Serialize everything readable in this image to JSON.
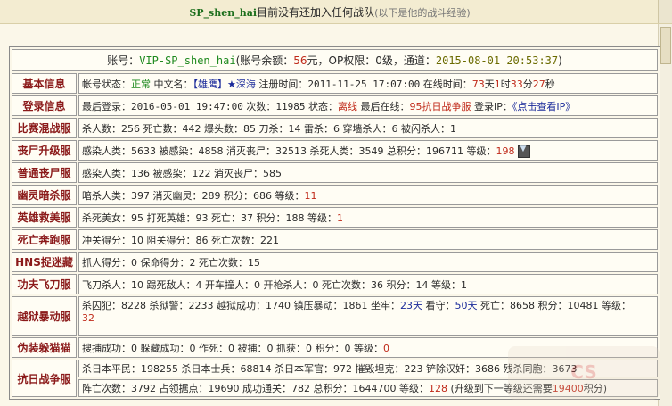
{
  "header": {
    "name": "SP_shen_hai",
    "text": "目前没有还加入任何战队",
    "note": "(以下是他的战斗经验)"
  },
  "account": {
    "prefix": "账号：",
    "id": "VIP-SP_shen_hai",
    "balance_prefix": "(账号余额：",
    "balance": "56",
    "balance_suffix": "元，OP权限：0级，通道：",
    "time": "2015-08-01 20:53:37",
    "close": ")"
  },
  "rows": {
    "basic": {
      "label": "基本信息",
      "status_label": "帐号状态：",
      "status": "正常",
      "cn_label": "中文名：",
      "cn_name": "【雄鹰】",
      "star": "★",
      "cn_name2": "深海",
      "reg_label": " 注册时间：",
      "reg_time": "2011-11-25 17:07:00",
      "online_label": " 在线时间：",
      "online_d": "73",
      "online_d_u": "天",
      "online_h": "1",
      "online_h_u": "时",
      "online_m": "33",
      "online_m_u": "分",
      "online_s": "27",
      "online_s_u": "秒"
    },
    "login": {
      "label": "登录信息",
      "last_label": "最后登录：",
      "last_time": "2016-05-01 19:47:00",
      "count_label": " 次数：",
      "count": "11985",
      "state_label": " 状态：",
      "state": "离线",
      "last_online_label": " 最后在线：",
      "last_online": "95抗日战争服",
      "ip_label": " 登录IP：",
      "ip": "《点击查看IP》"
    },
    "mixed": {
      "label": "比赛混战服",
      "text": "杀人数：256 死亡数：442 爆头数：85 刀杀：14 雷杀：6 穿墙杀人：6 被闪杀人：1"
    },
    "zombie_up": {
      "label": "丧尸升级服",
      "text": "感染人类：5633 被感染：4858 消灭丧尸：32513 杀死人类：3549 总积分：196711 等级：",
      "level": "198"
    },
    "zombie_normal": {
      "label": "普通丧尸服",
      "text": "感染人类：136 被感染：122 消灭丧尸：585"
    },
    "ghost": {
      "label": "幽灵暗杀服",
      "text": "暗杀人类：397 消灭幽灵：289 积分：686 等级：",
      "level": "11"
    },
    "hero": {
      "label": "英雄救美服",
      "text": "杀死美女：95 打死英雄：93 死亡：37 积分：188 等级：",
      "level": "1"
    },
    "death_run": {
      "label": "死亡奔跑服",
      "text": "冲关得分：10 阻关得分：86 死亡次数：221"
    },
    "hns": {
      "label": "HNS捉迷藏",
      "text": "抓人得分：0 保命得分：2 死亡次数：15"
    },
    "kungfu": {
      "label": "功夫飞刀服",
      "text": "飞刀杀人：10 踢死敌人：4 开车撞人：0 开枪杀人：0 死亡次数：36 积分：14 等级：1"
    },
    "jailbreak": {
      "label": "越狱暴动服",
      "p1": "杀囚犯：8228 杀狱警：2233 越狱成功：1740 镇压暴动：1861 坐牢：",
      "jail": "23天",
      "p2": " 看守：",
      "guard": "50天",
      "p3": " 死亡：8658 积分：10481 等级：",
      "level": "32"
    },
    "disguise": {
      "label": "伪装躲猫猫",
      "text": "搜捕成功：0 躲藏成功：0 作死：0 被捕：0 抓获：0 积分：0 等级：",
      "level": "0"
    },
    "war": {
      "label": "抗日战争服",
      "line1": "杀日本平民：198255 杀日本士兵：68814 杀日本军官：972 摧毁坦克：223 铲除汉奸：3686 残杀同胞：3673",
      "line2a": "阵亡次数：3792 占领据点：19690 成功通关：782 总积分：1644700 等级：",
      "level": "128",
      "line2b": " (升级到下一等级还需要",
      "need": "19400",
      "line2c": "积分)"
    }
  }
}
